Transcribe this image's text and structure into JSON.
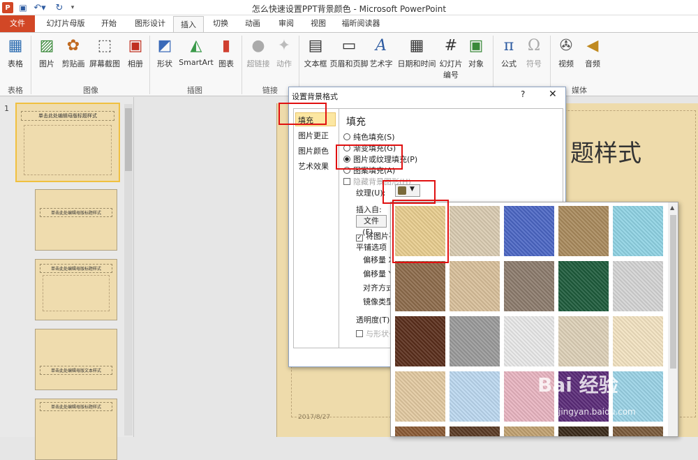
{
  "title_bar": {
    "app_icon_letter": "P",
    "title": "怎么快速设置PPT背景颜色 - Microsoft PowerPoint"
  },
  "tabs": [
    "文件",
    "幻灯片母版",
    "开始",
    "图形设计",
    "插入",
    "切换",
    "动画",
    "审阅",
    "视图",
    "福昕阅读器"
  ],
  "active_tab": "插入",
  "ribbon": {
    "buttons": [
      "表格",
      "图片",
      "剪贴画",
      "屏幕截图",
      "相册",
      "形状",
      "SmartArt",
      "图表",
      "超链接",
      "动作",
      "文本框",
      "页眉和页脚",
      "艺术字",
      "日期和时间",
      "幻灯片\n编号",
      "对象",
      "公式",
      "符号",
      "视频",
      "音频"
    ],
    "groups": [
      "表格",
      "图像",
      "插图",
      "链接",
      "媒体"
    ]
  },
  "slide_panel": {
    "number": "1",
    "thumb_title": "单击此处编辑母版标题样式",
    "thumb_body": "单击此处编辑母版文本样式"
  },
  "slide": {
    "title_fragment": "题样式",
    "date": "2017/8/27"
  },
  "dialog": {
    "title": "设置背景格式",
    "help": "?",
    "close": "✕",
    "nav": [
      "填充",
      "图片更正",
      "图片颜色",
      "艺术效果"
    ],
    "fill_heading": "填充",
    "options": [
      "纯色填充(S)",
      "渐变填充(G)",
      "图片或纹理填充(P)",
      "图案填充(A)"
    ],
    "selected_option": "图片或纹理填充(P)",
    "hide_graphics": "隐藏背景图形(H)",
    "texture_label": "纹理(U):",
    "insert_from": "插入自:",
    "file_button": "文件(F)...",
    "tile_checkbox": "将图片平",
    "tile_options": "平铺选项",
    "offset_x": "偏移量 X",
    "offset_y": "偏移量 Y",
    "align": "对齐方式",
    "mirror": "镜像类型",
    "transparency": "透明度(T):",
    "rotate_with_shape": "与形状一"
  },
  "gallery": {
    "colors": [
      [
        "#e8cd8e",
        "#d9cbb1",
        "#4b66c4",
        "#a98a5c",
        "#8fd3e4"
      ],
      [
        "#8d6b4b",
        "#d8bf9a",
        "#8c7b6c",
        "#1d5b3b",
        "#d4d4d4"
      ],
      [
        "#5a2e1b",
        "#9a9a9a",
        "#e8e8e8",
        "#ddd0b7",
        "#f3e3c1"
      ],
      [
        "#e2c9a0",
        "#bcd8f0",
        "#e8b4c0",
        "#5a2a78",
        "#9ad3e6"
      ],
      [
        "#8a5a34",
        "#5a3a24",
        "#c0a070",
        "#3a2a1a",
        "#7a5a3a"
      ]
    ]
  },
  "watermark": {
    "text": "Bai 经验",
    "url": "jingyan.baidu.com"
  }
}
